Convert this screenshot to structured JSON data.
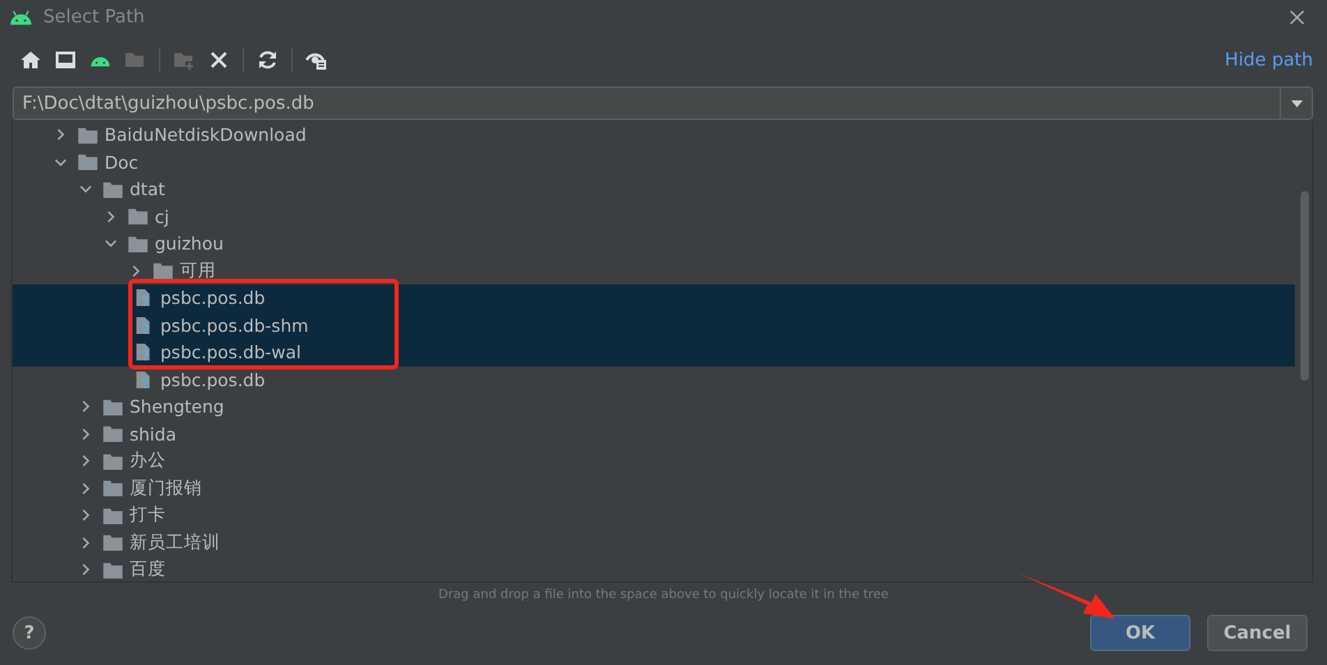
{
  "window": {
    "title": "Select Path"
  },
  "toolbar": {
    "link": "Hide path"
  },
  "path_field": {
    "value": "F:\\Doc\\dtat\\guizhou\\psbc.pos.db"
  },
  "tree": [
    {
      "kind": "folder",
      "label": "BaiduNetdiskDownload",
      "expanded": false,
      "selected": false
    },
    {
      "kind": "folder",
      "label": "Doc",
      "expanded": true,
      "selected": false,
      "children": [
        {
          "kind": "folder",
          "label": "dtat",
          "expanded": true,
          "selected": false,
          "children": [
            {
              "kind": "folder",
              "label": "cj",
              "expanded": false,
              "selected": false
            },
            {
              "kind": "folder",
              "label": "guizhou",
              "expanded": true,
              "selected": false,
              "children": [
                {
                  "kind": "folder",
                  "label": "可用",
                  "expanded": false,
                  "selected": false
                },
                {
                  "kind": "file",
                  "label": "psbc.pos.db",
                  "selected": true
                },
                {
                  "kind": "file",
                  "label": "psbc.pos.db-shm",
                  "selected": true
                },
                {
                  "kind": "file",
                  "label": "psbc.pos.db-wal",
                  "selected": true
                },
                {
                  "kind": "file",
                  "label": "psbc.pos.db",
                  "selected": false
                }
              ]
            }
          ]
        },
        {
          "kind": "folder",
          "label": "Shengteng",
          "expanded": false,
          "selected": false
        },
        {
          "kind": "folder",
          "label": "shida",
          "expanded": false,
          "selected": false
        },
        {
          "kind": "folder",
          "label": "办公",
          "expanded": false,
          "selected": false
        },
        {
          "kind": "folder",
          "label": "厦门报销",
          "expanded": false,
          "selected": false
        },
        {
          "kind": "folder",
          "label": "打卡",
          "expanded": false,
          "selected": false
        },
        {
          "kind": "folder",
          "label": "新员工培训",
          "expanded": false,
          "selected": false
        },
        {
          "kind": "folder",
          "label": "百度",
          "expanded": false,
          "selected": false
        }
      ]
    }
  ],
  "hint": "Drag and drop a file into the space above to quickly locate it in the tree",
  "help": "?",
  "buttons": [
    {
      "label": "OK",
      "default": true
    },
    {
      "label": "Cancel",
      "default": false
    }
  ]
}
